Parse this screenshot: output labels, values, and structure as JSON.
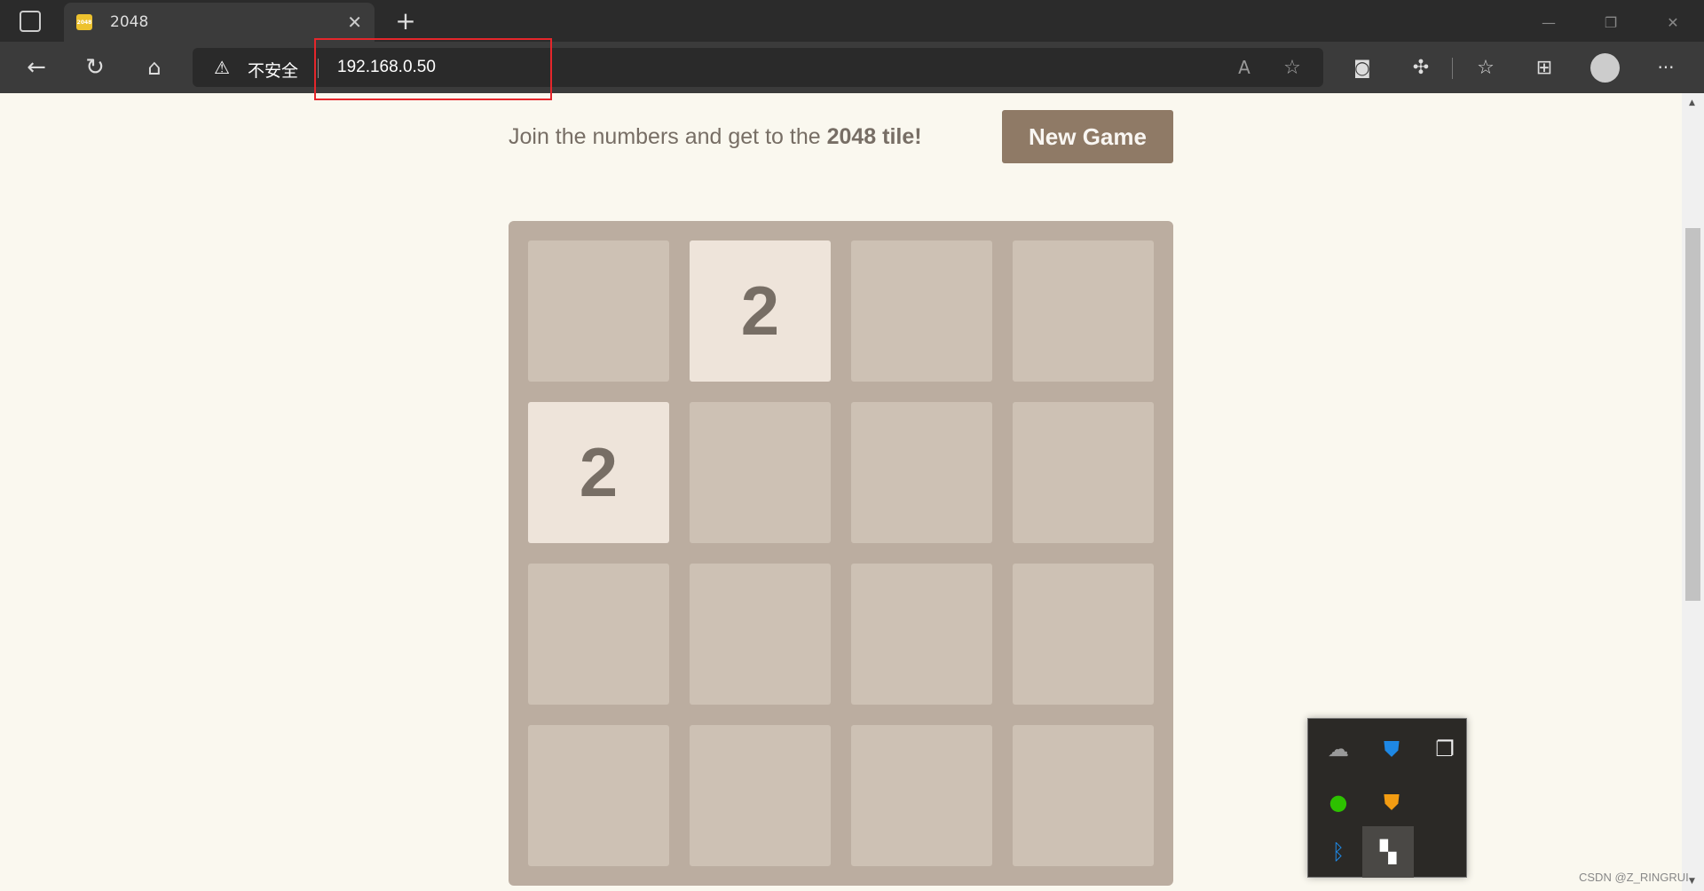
{
  "browser": {
    "tab_title": "2048",
    "favicon_text": "2048",
    "insecure_label": "不安全",
    "url": "192.168.0.50"
  },
  "game": {
    "tagline_prefix": "Join the numbers and get to the ",
    "tagline_bold": "2048 tile!",
    "new_game_label": "New Game",
    "grid": [
      [
        null,
        2,
        null,
        null
      ],
      [
        2,
        null,
        null,
        null
      ],
      [
        null,
        null,
        null,
        null
      ],
      [
        null,
        null,
        null,
        null
      ]
    ]
  },
  "colors": {
    "background": "#faf8ef",
    "board": "#bbada0",
    "empty_cell": "#cdc1b4",
    "tile_2": "#eee4da",
    "button": "#8f7a66",
    "highlight": "#e5262b"
  },
  "tray_icons": [
    "onedrive-icon",
    "windows-security-icon",
    "screen-capture-icon",
    "wechat-icon",
    "antivirus-shield-icon",
    "bluetooth-icon",
    "app-icon"
  ],
  "watermark": "CSDN @Z_RINGRUI"
}
